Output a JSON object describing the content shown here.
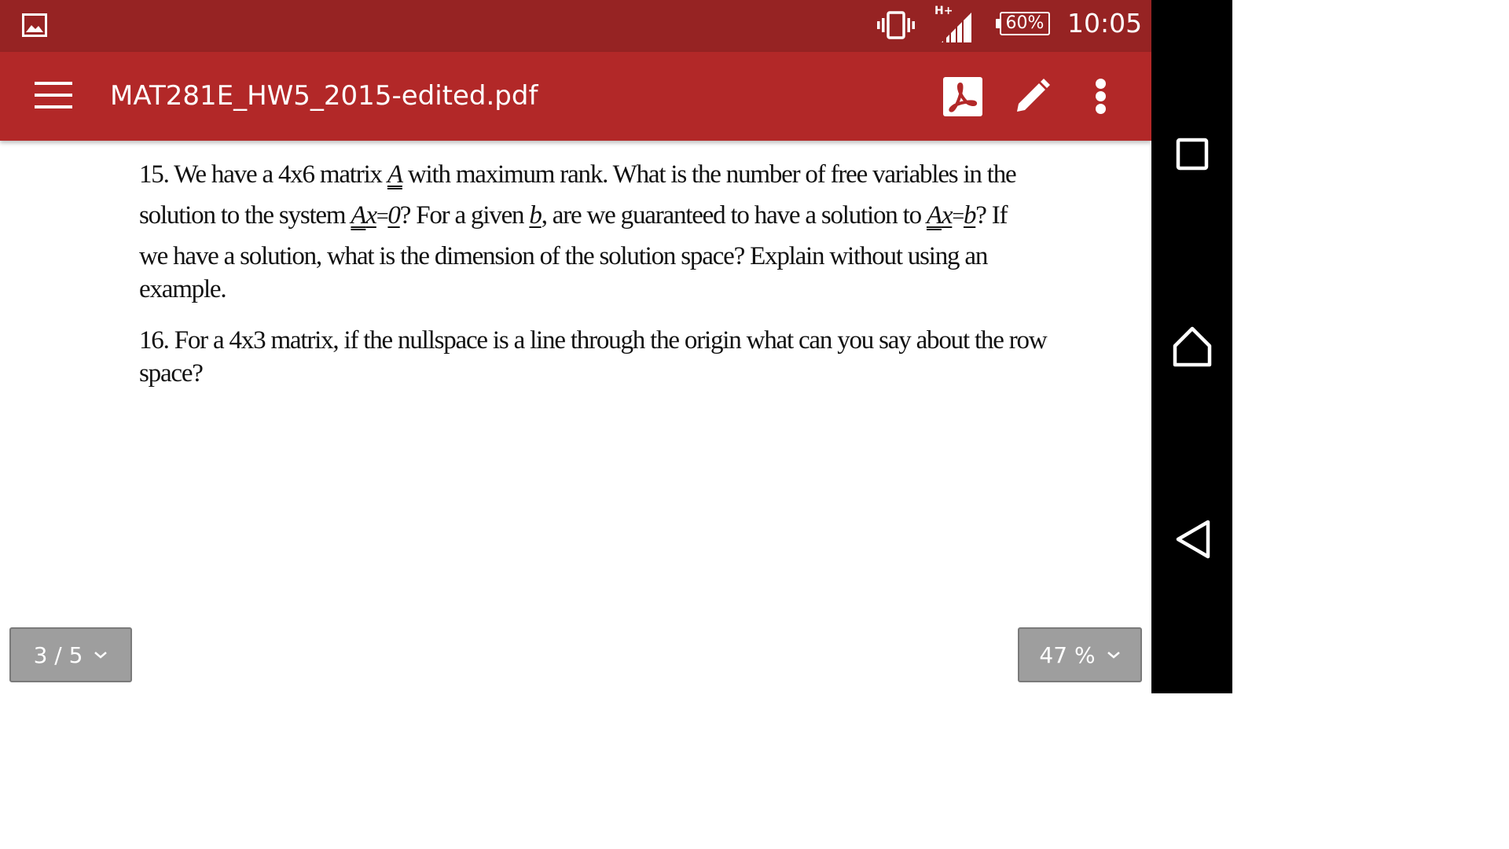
{
  "status_bar": {
    "network_type": "H+",
    "battery": "60%",
    "time": "10:05",
    "icons": [
      "image-notification-icon",
      "vibrate-icon",
      "signal-icon",
      "battery-icon"
    ]
  },
  "app_bar": {
    "title": "MAT281E_HW5_2015-edited.pdf",
    "icons": [
      "menu-icon",
      "pdf-icon",
      "edit-icon",
      "more-vert-icon"
    ]
  },
  "document": {
    "q15": {
      "line1_a": "15. We have a 4x6 matrix ",
      "line1_A": "A",
      "line1_b": " with maximum rank. What is the number of free variables in the",
      "line2_a": "solution to the system ",
      "line2_A1": "A",
      "line2_x1": "x",
      "line2_eq1": "=",
      "line2_zero": "0",
      "line2_b": "? For a given ",
      "line2_bvar": "b",
      "line2_c": ", are we guaranteed to have a solution to ",
      "line2_A2": "A",
      "line2_x2": "x",
      "line2_eq2": "=",
      "line2_bvar2": "b",
      "line2_d": "? If",
      "line3": "we have a solution, what is the dimension of the solution space? Explain without using an",
      "line4": "example."
    },
    "q16": {
      "line1": "16. For a 4x3 matrix, if the nullspace is a line through the origin what can you say about the row",
      "line2": "space?"
    }
  },
  "controls": {
    "page_indicator": "3 / 5",
    "zoom_level": "47 %"
  },
  "nav_bar": {
    "icons": [
      "recents-icon",
      "home-icon",
      "back-icon"
    ]
  },
  "colors": {
    "status_bar": "#962323",
    "app_bar": "#b22828",
    "nav_bar": "#000000",
    "control_button": "#9e9e9e"
  }
}
